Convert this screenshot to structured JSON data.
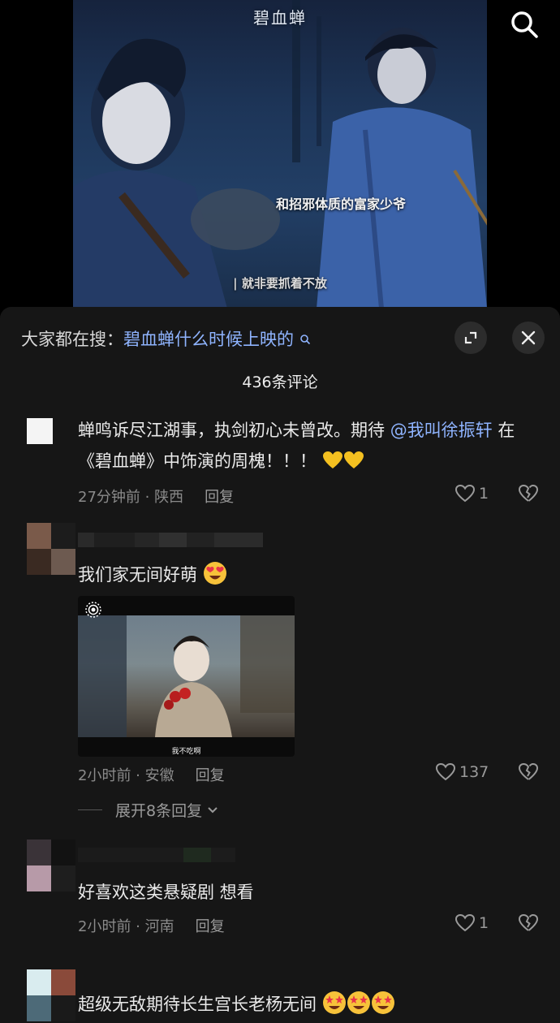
{
  "video": {
    "show_logo": "碧血蝉",
    "subtitle_top": "和招邪体质的富家少爷",
    "subtitle_bottom": "| 就非要抓着不放"
  },
  "search_hint": {
    "prefix": "大家都在搜：",
    "query": "碧血蝉什么时候上映的"
  },
  "comment_count": "436条评论",
  "comments": [
    {
      "text_before": "蝉鸣诉尽江湖事，执剑初心未曾改。期待 ",
      "mention": "@我叫徐振轩",
      "text_after": " 在《碧血蝉》中饰演的周槐！！！",
      "time_location": "27分钟前 · 陕西",
      "reply_label": "回复",
      "likes": "1",
      "emojis": [
        "yellow-heart",
        "yellow-heart"
      ]
    },
    {
      "text": "我们家无间好萌",
      "time_location": "2小时前 · 安徽",
      "reply_label": "回复",
      "likes": "137",
      "media_caption": "我不吃啊",
      "expand_replies": "展开8条回复",
      "emojis": [
        "heart-eyes-face"
      ]
    },
    {
      "text": "好喜欢这类悬疑剧  想看",
      "time_location": "2小时前 · 河南",
      "reply_label": "回复",
      "likes": "1"
    },
    {
      "text": "超级无敌期待长生宫长老杨无间",
      "emojis": [
        "star-struck-face",
        "star-struck-face",
        "star-struck-face"
      ]
    }
  ],
  "colors": {
    "sheet_bg": "#161616",
    "link_blue": "#8fb4ff",
    "meta_gray": "#8a8a8a"
  }
}
